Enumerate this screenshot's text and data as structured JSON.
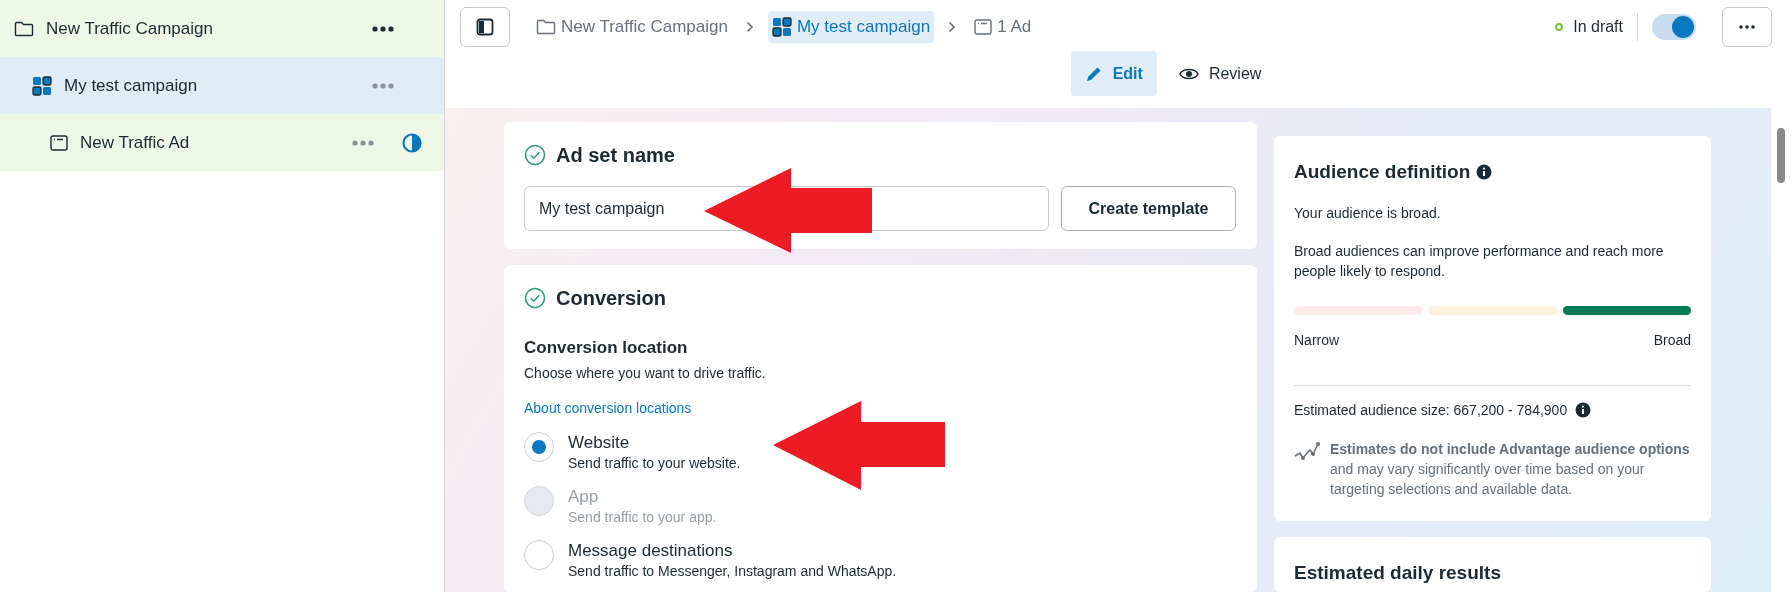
{
  "sidebar": {
    "items": [
      {
        "label": "New Traffic Campaign",
        "kind": "campaign",
        "selected": false,
        "children": [
          {
            "label": "My test campaign",
            "kind": "adset",
            "selected": true,
            "children": [
              {
                "label": "New Traffic Ad",
                "kind": "ad",
                "selected": false,
                "level": 0.5
              }
            ]
          }
        ]
      }
    ]
  },
  "breadcrumb": [
    {
      "label": "New Traffic Campaign",
      "kind": "campaign",
      "selected": false
    },
    {
      "label": "My test campaign",
      "kind": "adset",
      "selected": true
    },
    {
      "label": "1 Ad",
      "kind": "ad",
      "selected": false
    }
  ],
  "status": {
    "label": "In draft",
    "color": "#7bc043"
  },
  "toggle": {
    "on": true
  },
  "tabs": [
    {
      "label": "Edit",
      "kind": "edit",
      "selected": true
    },
    {
      "label": "Review",
      "kind": "review",
      "selected": false
    }
  ],
  "ad_set_name": {
    "title": "Ad set name",
    "value": "My test campaign",
    "button": "Create template"
  },
  "conversion": {
    "title": "Conversion",
    "subtitle": "Conversion location",
    "description": "Choose where you want to drive traffic.",
    "link": "About conversion locations",
    "options": [
      {
        "label": "Website",
        "description": "Send traffic to your website.",
        "selected": true,
        "disabled": false
      },
      {
        "label": "App",
        "description": "Send traffic to your app.",
        "selected": false,
        "disabled": true
      },
      {
        "label": "Message destinations",
        "description": "Send traffic to Messenger, Instagram and WhatsApp.",
        "selected": false,
        "disabled": false
      }
    ]
  },
  "audience": {
    "title": "Audience definition",
    "summary": "Your audience is broad.",
    "description": "Broad audiences can improve performance and reach more people likely to respond.",
    "segments": [
      {
        "color": "#fde8ea"
      },
      {
        "color": "#fdf3dc"
      },
      {
        "color": "#007a55"
      }
    ],
    "low_label": "Narrow",
    "high_label": "Broad",
    "size": "Estimated audience size: 667,200 - 784,900",
    "note": "**Estimates do not include Advantage audience options** and may vary significantly over time based on your targeting selections and available data."
  },
  "daily_results": {
    "title": "Estimated daily results"
  }
}
